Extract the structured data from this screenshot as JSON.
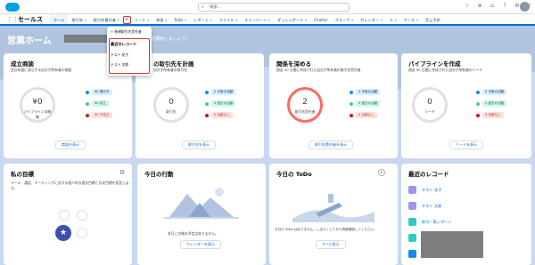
{
  "header": {
    "search_placeholder": "検索..."
  },
  "nav": {
    "app_name": "セールス",
    "tabs": [
      {
        "label": "ホーム",
        "active": true,
        "caret": false
      },
      {
        "label": "取引先",
        "active": false,
        "caret": true
      },
      {
        "label": "取引先責任者",
        "active": false,
        "caret": true
      },
      {
        "label": "リード",
        "active": false,
        "caret": true
      },
      {
        "label": "商談",
        "active": false,
        "caret": true
      },
      {
        "label": "ToDo",
        "active": false,
        "caret": true
      },
      {
        "label": "レポート",
        "active": false,
        "caret": true
      },
      {
        "label": "ファイル",
        "active": false,
        "caret": true
      },
      {
        "label": "キャンペーン",
        "active": false,
        "caret": true
      },
      {
        "label": "ダッシュボード",
        "active": false,
        "caret": true
      },
      {
        "label": "Chatter",
        "active": false,
        "caret": false
      },
      {
        "label": "グループ",
        "active": false,
        "caret": true
      },
      {
        "label": "カレンダー",
        "active": false,
        "caret": true
      },
      {
        "label": "人",
        "active": false,
        "caret": true
      },
      {
        "label": "ケース",
        "active": false,
        "caret": true
      },
      {
        "label": "売上予測",
        "active": false,
        "caret": false
      }
    ]
  },
  "dropdown": {
    "new_item": "新規取引先責任者",
    "section_title": "最近のレコード",
    "items": [
      "テスト 花子",
      "テスト 太郎"
    ]
  },
  "page": {
    "title": "営業ホーム",
    "subtitle": "、さあ営業を開始しましょう!"
  },
  "cards": {
    "deals": {
      "title": "成立商談",
      "desc": "会計年度に成立する自分が所有者の商談",
      "ring_value": "¥0",
      "ring_label": "パイプラインの総額",
      "legend": [
        "¥0 進行中",
        "¥0 成立",
        "¥0 不成立"
      ],
      "button": "商談を表示"
    },
    "plan": {
      "title": "の取引先を計画",
      "desc": "自分が所有者の取引先",
      "ring_value": "0",
      "ring_label": "取引先",
      "legend": [
        "0 今後の活動",
        "0 過去の活動",
        "0 活動なし"
      ],
      "button": "取引先を表示"
    },
    "relations": {
      "title": "関係を深める",
      "desc": "過去 90 日間に作成された自分が所有者の取引先責任者",
      "ring_value": "2",
      "ring_label": "取引先責任者",
      "legend": [
        "2 今後の活動",
        "0 過去の活動",
        "0 活動なし"
      ],
      "button": "取引先責任者を表示"
    },
    "pipeline": {
      "title": "パイプラインを作成",
      "desc": "過去 90 日間に作成された自分が所有者のリード",
      "ring_value": "0",
      "ring_label": "リード",
      "legend": [
        "0 今後の活動",
        "0 過去の活動",
        "0 活動なし"
      ],
      "button": "リードを表示"
    },
    "goals": {
      "title": "私の目標",
      "desc": "メール、通話、ミーティングに対する個人的な週次目標と月次目標を設定します。"
    },
    "today": {
      "title": "今日の行動",
      "empty_text": "本日この後の予定はありません。",
      "button": "カレンダーを表示"
    },
    "todo": {
      "title": "今日の ToDo",
      "empty_text": "今日の ToDo はありません。しばらくしてから再度確認してください。",
      "button": "すべて表示"
    },
    "recent": {
      "title": "最近のレコード",
      "items": [
        "テスト 花子",
        "テスト 太郎",
        "取引一覧レポート"
      ]
    }
  },
  "colors": {
    "brand": "#0070d2",
    "highlight_ring": "#ff6a5c",
    "dropdown_border": "#c23934"
  },
  "icons": [
    "search-icon",
    "star-icon",
    "plus-icon",
    "help-icon",
    "gear-icon",
    "bell-icon",
    "waffle-icon",
    "caret-icon"
  ]
}
